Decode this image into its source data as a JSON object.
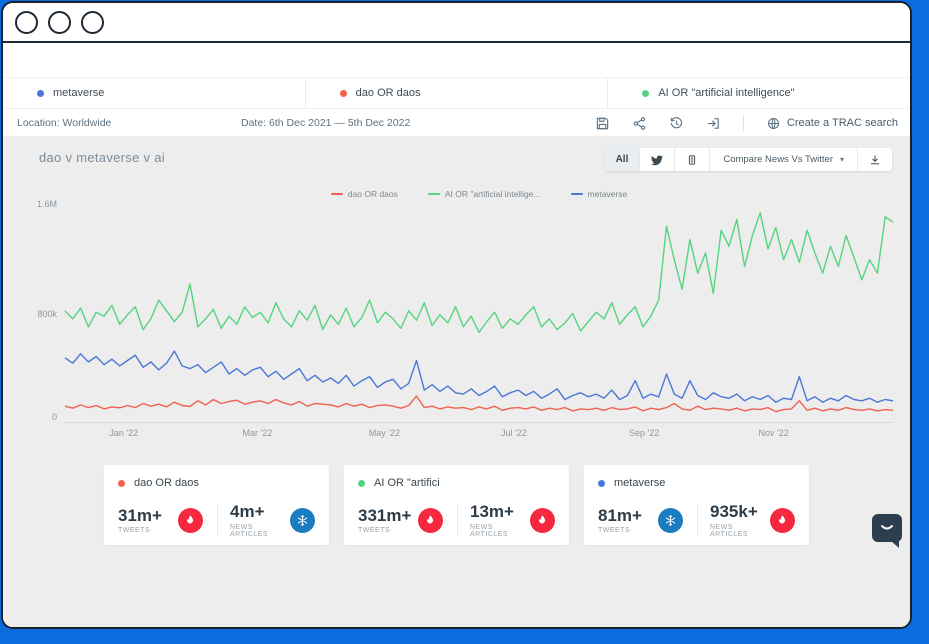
{
  "terms": [
    {
      "label": "metaverse",
      "color": "#4a77d7"
    },
    {
      "label": "dao OR daos",
      "color": "#f0624e"
    },
    {
      "label": "AI OR \"artificial intelligence\"",
      "color": "#55d47f"
    }
  ],
  "toolbar": {
    "location_label": "Location:",
    "location_value": "Worldwide",
    "date_label": "Date:",
    "date_value": "6th Dec 2021 — 5th Dec 2022",
    "icons": [
      "save-icon",
      "share-icon",
      "history-icon",
      "export-icon"
    ],
    "create_search": {
      "icon": "globe-icon",
      "label": "Create a TRAC search"
    }
  },
  "chart_header": {
    "title": "dao v metaverse v ai",
    "filters": {
      "all_label": "All",
      "twitter_icon": "twitter-icon",
      "news_icon": "news-icon"
    },
    "compare": {
      "label": "Compare News Vs Twitter",
      "caret": "▾"
    },
    "download_icon": "download-icon"
  },
  "legend": [
    {
      "label": "dao OR daos",
      "color": "#f0624e"
    },
    {
      "label": "AI OR \"artificial intellige...",
      "color": "#55d47f"
    },
    {
      "label": "metaverse",
      "color": "#4a77d7"
    }
  ],
  "axis": {
    "y_ticks": [
      "1.6M",
      "800k",
      "0"
    ],
    "x_ticks": [
      "Jan '22",
      "Mar '22",
      "May '22",
      "Jul '22",
      "Sep '22",
      "Nov '22"
    ]
  },
  "chart_data": {
    "type": "line",
    "title": "dao v metaverse v ai",
    "x_range": [
      "6th Dec 2021",
      "5th Dec 2022"
    ],
    "x_ticks": [
      "Jan '22",
      "Mar '22",
      "May '22",
      "Jul '22",
      "Sep '22",
      "Nov '22"
    ],
    "y_ticks": [
      "1.6M",
      "800k",
      "0"
    ],
    "ylim": [
      0,
      1600
    ],
    "unit": "mentions per interval, thousands",
    "grid": false,
    "legend_position": "top",
    "series": [
      {
        "name": "dao OR daos",
        "color": "#f0624e",
        "values": [
          110,
          95,
          120,
          100,
          115,
          90,
          105,
          98,
          115,
          100,
          130,
          110,
          125,
          105,
          140,
          115,
          108,
          150,
          120,
          160,
          130,
          145,
          155,
          125,
          140,
          150,
          130,
          160,
          135,
          120,
          145,
          110,
          130,
          125,
          120,
          105,
          130,
          110,
          125,
          100,
          115,
          120,
          110,
          95,
          115,
          185,
          100,
          110,
          90,
          105,
          95,
          100,
          85,
          105,
          90,
          110,
          80,
          95,
          100,
          90,
          105,
          80,
          95,
          85,
          100,
          75,
          90,
          85,
          95,
          80,
          100,
          85,
          90,
          105,
          75,
          95,
          85,
          100,
          130,
          90,
          80,
          110,
          85,
          95,
          90,
          80,
          95,
          75,
          90,
          85,
          100,
          70,
          85,
          90,
          150,
          80,
          95,
          75,
          90,
          80,
          100,
          85,
          80,
          90,
          75,
          85,
          80
        ]
      },
      {
        "name": "AI OR \"artificial intellige...",
        "color": "#55d47f",
        "values": [
          820,
          760,
          840,
          700,
          810,
          780,
          860,
          720,
          790,
          850,
          680,
          760,
          900,
          820,
          740,
          810,
          1020,
          700,
          760,
          830,
          690,
          780,
          720,
          850,
          770,
          810,
          730,
          880,
          760,
          700,
          820,
          750,
          860,
          680,
          790,
          720,
          840,
          700,
          770,
          900,
          730,
          810,
          760,
          690,
          820,
          750,
          880,
          710,
          790,
          730,
          850,
          700,
          780,
          660,
          740,
          810,
          690,
          760,
          720,
          790,
          850,
          700,
          760,
          680,
          730,
          800,
          670,
          740,
          810,
          760,
          880,
          720,
          790,
          850,
          700,
          780,
          900,
          1450,
          1200,
          980,
          1350,
          1100,
          1250,
          950,
          1420,
          1300,
          1500,
          1150,
          1380,
          1550,
          1280,
          1440,
          1200,
          1350,
          1180,
          1420,
          1250,
          1100,
          1300,
          1150,
          1380,
          1220,
          1050,
          1200,
          1100,
          1520,
          1480
        ]
      },
      {
        "name": "metaverse",
        "color": "#4a77d7",
        "values": [
          470,
          430,
          500,
          440,
          480,
          420,
          460,
          410,
          450,
          490,
          400,
          440,
          380,
          430,
          520,
          410,
          390,
          420,
          360,
          400,
          440,
          350,
          390,
          340,
          380,
          400,
          330,
          370,
          310,
          350,
          390,
          300,
          340,
          290,
          320,
          280,
          340,
          260,
          300,
          330,
          250,
          290,
          310,
          240,
          280,
          450,
          230,
          270,
          220,
          260,
          210,
          200,
          240,
          190,
          220,
          260,
          180,
          210,
          230,
          190,
          220,
          170,
          200,
          240,
          160,
          190,
          210,
          180,
          200,
          170,
          230,
          160,
          190,
          300,
          170,
          200,
          180,
          350,
          200,
          170,
          300,
          190,
          160,
          210,
          180,
          170,
          200,
          150,
          180,
          160,
          190,
          140,
          170,
          160,
          330,
          150,
          180,
          140,
          170,
          150,
          190,
          160,
          150,
          170,
          140,
          160,
          150
        ]
      }
    ]
  },
  "cards": [
    {
      "term": "dao OR daos",
      "color": "#f0624e",
      "stats": [
        {
          "value": "31m+",
          "label": "TWEETS",
          "icon": "fire-icon",
          "color": "#f5293d"
        },
        {
          "value": "4m+",
          "label": "NEWS ARTICLES",
          "icon": "snowflake-icon",
          "color": "#1a7dc0"
        }
      ]
    },
    {
      "term": "AI OR \"artifici",
      "color": "#55d47f",
      "stats": [
        {
          "value": "331m+",
          "label": "TWEETS",
          "icon": "fire-icon",
          "color": "#f5293d"
        },
        {
          "value": "13m+",
          "label": "NEWS ARTICLES",
          "icon": "fire-icon",
          "color": "#f5293d"
        }
      ]
    },
    {
      "term": "metaverse",
      "color": "#4a77d7",
      "stats": [
        {
          "value": "81m+",
          "label": "TWEETS",
          "icon": "snowflake-icon",
          "color": "#1a7dc0"
        },
        {
          "value": "935k+",
          "label": "NEWS ARTICLES",
          "icon": "fire-icon",
          "color": "#f5293d"
        }
      ]
    }
  ],
  "chat": {
    "icon": "chat-bubble-icon"
  },
  "colors": {
    "page_background": "#0b6ce0",
    "panel_background": "#ededed",
    "window_border": "#18222c"
  }
}
